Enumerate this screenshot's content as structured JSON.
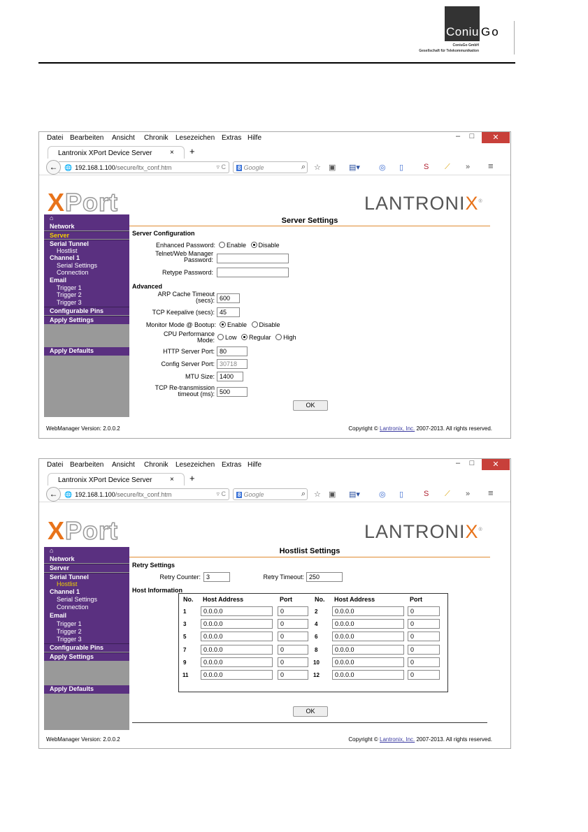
{
  "company": {
    "logo_text_1": "Coniu",
    "logo_text_2": "Go",
    "subline_1": "ConiuGo GmbH",
    "subline_2": "Gesellschaft für Telekommunikation"
  },
  "browser": {
    "menu": [
      "Datei",
      "Bearbeiten",
      "Ansicht",
      "Chronik",
      "Lesezeichen",
      "Extras",
      "Hilfe"
    ],
    "tab_title": "Lantronix XPort Device Server",
    "tab_close": "×",
    "new_tab": "+",
    "url_host": "192.168.1.100",
    "url_path": "/secure/ltx_conf.htm",
    "search_placeholder": "Google",
    "search_engine_icon": "google-icon",
    "minimize": "–",
    "maximize": "□",
    "close": "✕"
  },
  "banner": {
    "xport_x": "X",
    "xport_rest": "Port",
    "lantronix": "LANTRONI",
    "lantronix_x": "X"
  },
  "sidebar": {
    "home_icon": "home-icon",
    "items": [
      "Network",
      "Server",
      "Serial Tunnel",
      "Hostlist",
      "Channel 1",
      "Serial Settings",
      "Connection",
      "Email",
      "Trigger 1",
      "Trigger 2",
      "Trigger 3",
      "Configurable Pins",
      "Apply Settings",
      "Apply Defaults"
    ]
  },
  "server_page": {
    "title": "Server Settings",
    "section_config": "Server Configuration",
    "enhanced_password_label": "Enhanced Password:",
    "enable": "Enable",
    "disable": "Disable",
    "enhanced_password_value": "Disable",
    "telnet_label_1": "Telnet/Web Manager",
    "telnet_label_2": "Password:",
    "retype_label": "Retype Password:",
    "section_advanced": "Advanced",
    "arp_label_1": "ARP Cache Timeout",
    "arp_label_2": "(secs):",
    "arp_value": "600",
    "keepalive_label": "TCP Keepalive (secs):",
    "keepalive_value": "45",
    "monitor_label": "Monitor Mode @ Bootup:",
    "monitor_value": "Enable",
    "cpu_label_1": "CPU Performance",
    "cpu_label_2": "Mode:",
    "cpu_low": "Low",
    "cpu_regular": "Regular",
    "cpu_high": "High",
    "cpu_value": "Regular",
    "http_label": "HTTP Server Port:",
    "http_value": "80",
    "config_label": "Config Server Port:",
    "config_value": "30718",
    "mtu_label": "MTU Size:",
    "mtu_value": "1400",
    "tcp_retx_label_1": "TCP Re-transmission",
    "tcp_retx_label_2": "timeout (ms):",
    "tcp_retx_value": "500",
    "ok": "OK"
  },
  "hostlist_page": {
    "title": "Hostlist Settings",
    "section_retry": "Retry Settings",
    "retry_counter_label": "Retry Counter:",
    "retry_counter_value": "3",
    "retry_timeout_label": "Retry Timeout:",
    "retry_timeout_value": "250",
    "section_host": "Host Information",
    "col_no": "No.",
    "col_address": "Host Address",
    "col_port": "Port",
    "hosts": [
      {
        "no": "1",
        "address": "0.0.0.0",
        "port": "0"
      },
      {
        "no": "2",
        "address": "0.0.0.0",
        "port": "0"
      },
      {
        "no": "3",
        "address": "0.0.0.0",
        "port": "0"
      },
      {
        "no": "4",
        "address": "0.0.0.0",
        "port": "0"
      },
      {
        "no": "5",
        "address": "0.0.0.0",
        "port": "0"
      },
      {
        "no": "6",
        "address": "0.0.0.0",
        "port": "0"
      },
      {
        "no": "7",
        "address": "0.0.0.0",
        "port": "0"
      },
      {
        "no": "8",
        "address": "0.0.0.0",
        "port": "0"
      },
      {
        "no": "9",
        "address": "0.0.0.0",
        "port": "0"
      },
      {
        "no": "10",
        "address": "0.0.0.0",
        "port": "0"
      },
      {
        "no": "11",
        "address": "0.0.0.0",
        "port": "0"
      },
      {
        "no": "12",
        "address": "0.0.0.0",
        "port": "0"
      }
    ],
    "ok": "OK"
  },
  "footer": {
    "version": "WebManager Version: 2.0.0.2",
    "copyright_pre": "Copyright ©",
    "copyright_link": "Lantronix, Inc.",
    "copyright_post": "2007-2013. All rights reserved."
  },
  "colors": {
    "sidebar_purple": "#5a3080",
    "selected_yellow": "#f0d000",
    "accent_orange": "#e8731a",
    "close_red": "#c8403a"
  }
}
